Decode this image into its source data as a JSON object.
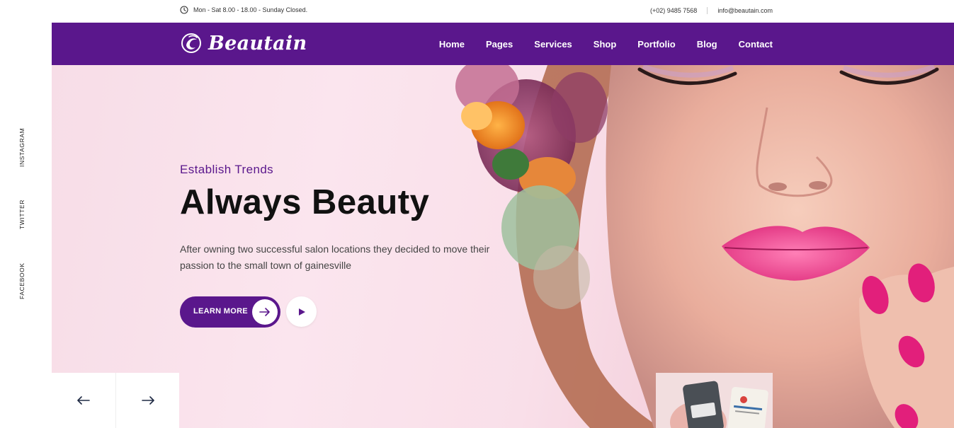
{
  "topbar": {
    "hours": "Mon - Sat 8.00 - 18.00 - Sunday Closed.",
    "phone": "(+02) 9485 7568",
    "email": "info@beautain.com"
  },
  "brand": {
    "name": "Beautain",
    "accent_color": "#5a178c"
  },
  "nav": {
    "items": [
      {
        "label": "Home"
      },
      {
        "label": "Pages"
      },
      {
        "label": "Services"
      },
      {
        "label": "Shop"
      },
      {
        "label": "Portfolio"
      },
      {
        "label": "Blog"
      },
      {
        "label": "Contact"
      }
    ]
  },
  "social": {
    "instagram": "INSTAGRAM",
    "twitter": "TWITTER",
    "facebook": "FACEBOOK"
  },
  "hero": {
    "eyebrow": "Establish Trends",
    "headline": "Always Beauty",
    "description": "After owning two successful salon locations they decided to move their passion to the small town of gainesville",
    "cta_label": "LEARN MORE",
    "icons": {
      "cta": "arrow-right-icon",
      "video": "play-icon"
    }
  },
  "slider": {
    "prev_icon": "arrow-left-icon",
    "next_icon": "arrow-right-icon"
  }
}
